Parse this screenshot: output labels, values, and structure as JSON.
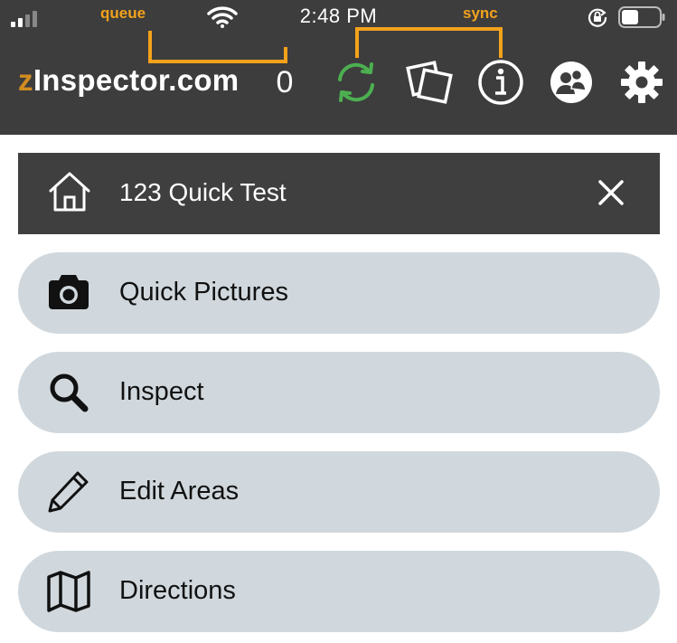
{
  "status_bar": {
    "time": "2:48 PM"
  },
  "annotations": {
    "queue_label": "queue",
    "sync_label": "sync",
    "color": "#f3a21c"
  },
  "header": {
    "brand_prefix": "z",
    "brand_rest": "Inspector.com",
    "queue_count": "0",
    "icons": [
      "sync-icon",
      "photos-icon",
      "info-icon",
      "users-icon",
      "gear-icon"
    ],
    "sync_color": "#4caf50"
  },
  "inspection_card": {
    "title": "123 Quick Test",
    "icon": "home-icon",
    "close_icon": "close-icon"
  },
  "menu": {
    "items": [
      {
        "label": "Quick Pictures",
        "icon": "camera-icon"
      },
      {
        "label": "Inspect",
        "icon": "search-icon"
      },
      {
        "label": "Edit Areas",
        "icon": "pencil-icon"
      },
      {
        "label": "Directions",
        "icon": "map-icon"
      }
    ]
  }
}
